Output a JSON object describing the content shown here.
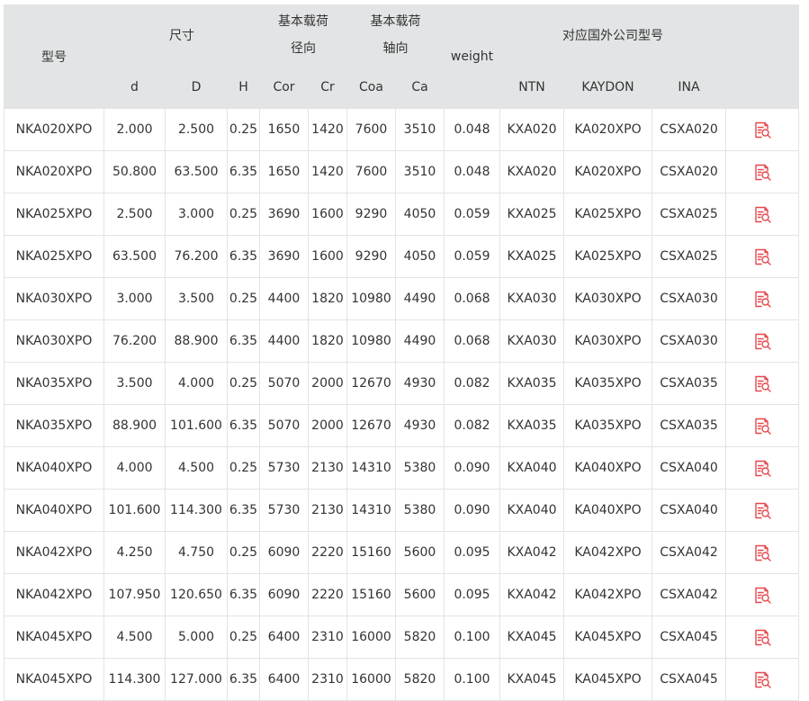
{
  "table": {
    "headers": {
      "model": "型号",
      "dimensions": "尺寸",
      "radial_load_title": "基本载荷",
      "radial_load_sub": "径向",
      "axial_load_title": "基本载荷",
      "axial_load_sub": "轴向",
      "weight": "weight",
      "foreign_models": "对应国外公司型号",
      "d": "d",
      "D": "D",
      "H": "H",
      "Cor": "Cor",
      "Cr": "Cr",
      "Coa": "Coa",
      "Ca": "Ca",
      "NTN": "NTN",
      "KAYDON": "KAYDON",
      "INA": "INA"
    },
    "accent_color": "#e8474b",
    "row_action_icon": "document-search-icon",
    "rows": [
      {
        "model": "NKA020XPO",
        "d": "2.000",
        "D": "2.500",
        "H": "0.25",
        "Cor": "1650",
        "Cr": "1420",
        "Coa": "7600",
        "Ca": "3510",
        "weight": "0.048",
        "ntn": "KXA020",
        "kaydon": "KA020XPO",
        "ina": "CSXA020"
      },
      {
        "model": "NKA020XPO",
        "d": "50.800",
        "D": "63.500",
        "H": "6.35",
        "Cor": "1650",
        "Cr": "1420",
        "Coa": "7600",
        "Ca": "3510",
        "weight": "0.048",
        "ntn": "KXA020",
        "kaydon": "KA020XPO",
        "ina": "CSXA020"
      },
      {
        "model": "NKA025XPO",
        "d": "2.500",
        "D": "3.000",
        "H": "0.25",
        "Cor": "3690",
        "Cr": "1600",
        "Coa": "9290",
        "Ca": "4050",
        "weight": "0.059",
        "ntn": "KXA025",
        "kaydon": "KA025XPO",
        "ina": "CSXA025"
      },
      {
        "model": "NKA025XPO",
        "d": "63.500",
        "D": "76.200",
        "H": "6.35",
        "Cor": "3690",
        "Cr": "1600",
        "Coa": "9290",
        "Ca": "4050",
        "weight": "0.059",
        "ntn": "KXA025",
        "kaydon": "KA025XPO",
        "ina": "CSXA025"
      },
      {
        "model": "NKA030XPO",
        "d": "3.000",
        "D": "3.500",
        "H": "0.25",
        "Cor": "4400",
        "Cr": "1820",
        "Coa": "10980",
        "Ca": "4490",
        "weight": "0.068",
        "ntn": "KXA030",
        "kaydon": "KA030XPO",
        "ina": "CSXA030"
      },
      {
        "model": "NKA030XPO",
        "d": "76.200",
        "D": "88.900",
        "H": "6.35",
        "Cor": "4400",
        "Cr": "1820",
        "Coa": "10980",
        "Ca": "4490",
        "weight": "0.068",
        "ntn": "KXA030",
        "kaydon": "KA030XPO",
        "ina": "CSXA030"
      },
      {
        "model": "NKA035XPO",
        "d": "3.500",
        "D": "4.000",
        "H": "0.25",
        "Cor": "5070",
        "Cr": "2000",
        "Coa": "12670",
        "Ca": "4930",
        "weight": "0.082",
        "ntn": "KXA035",
        "kaydon": "KA035XPO",
        "ina": "CSXA035"
      },
      {
        "model": "NKA035XPO",
        "d": "88.900",
        "D": "101.600",
        "H": "6.35",
        "Cor": "5070",
        "Cr": "2000",
        "Coa": "12670",
        "Ca": "4930",
        "weight": "0.082",
        "ntn": "KXA035",
        "kaydon": "KA035XPO",
        "ina": "CSXA035"
      },
      {
        "model": "NKA040XPO",
        "d": "4.000",
        "D": "4.500",
        "H": "0.25",
        "Cor": "5730",
        "Cr": "2130",
        "Coa": "14310",
        "Ca": "5380",
        "weight": "0.090",
        "ntn": "KXA040",
        "kaydon": "KA040XPO",
        "ina": "CSXA040"
      },
      {
        "model": "NKA040XPO",
        "d": "101.600",
        "D": "114.300",
        "H": "6.35",
        "Cor": "5730",
        "Cr": "2130",
        "Coa": "14310",
        "Ca": "5380",
        "weight": "0.090",
        "ntn": "KXA040",
        "kaydon": "KA040XPO",
        "ina": "CSXA040"
      },
      {
        "model": "NKA042XPO",
        "d": "4.250",
        "D": "4.750",
        "H": "0.25",
        "Cor": "6090",
        "Cr": "2220",
        "Coa": "15160",
        "Ca": "5600",
        "weight": "0.095",
        "ntn": "KXA042",
        "kaydon": "KA042XPO",
        "ina": "CSXA042"
      },
      {
        "model": "NKA042XPO",
        "d": "107.950",
        "D": "120.650",
        "H": "6.35",
        "Cor": "6090",
        "Cr": "2220",
        "Coa": "15160",
        "Ca": "5600",
        "weight": "0.095",
        "ntn": "KXA042",
        "kaydon": "KA042XPO",
        "ina": "CSXA042"
      },
      {
        "model": "NKA045XPO",
        "d": "4.500",
        "D": "5.000",
        "H": "0.25",
        "Cor": "6400",
        "Cr": "2310",
        "Coa": "16000",
        "Ca": "5820",
        "weight": "0.100",
        "ntn": "KXA045",
        "kaydon": "KA045XPO",
        "ina": "CSXA045"
      },
      {
        "model": "NKA045XPO",
        "d": "114.300",
        "D": "127.000",
        "H": "6.35",
        "Cor": "6400",
        "Cr": "2310",
        "Coa": "16000",
        "Ca": "5820",
        "weight": "0.100",
        "ntn": "KXA045",
        "kaydon": "KA045XPO",
        "ina": "CSXA045"
      }
    ]
  }
}
